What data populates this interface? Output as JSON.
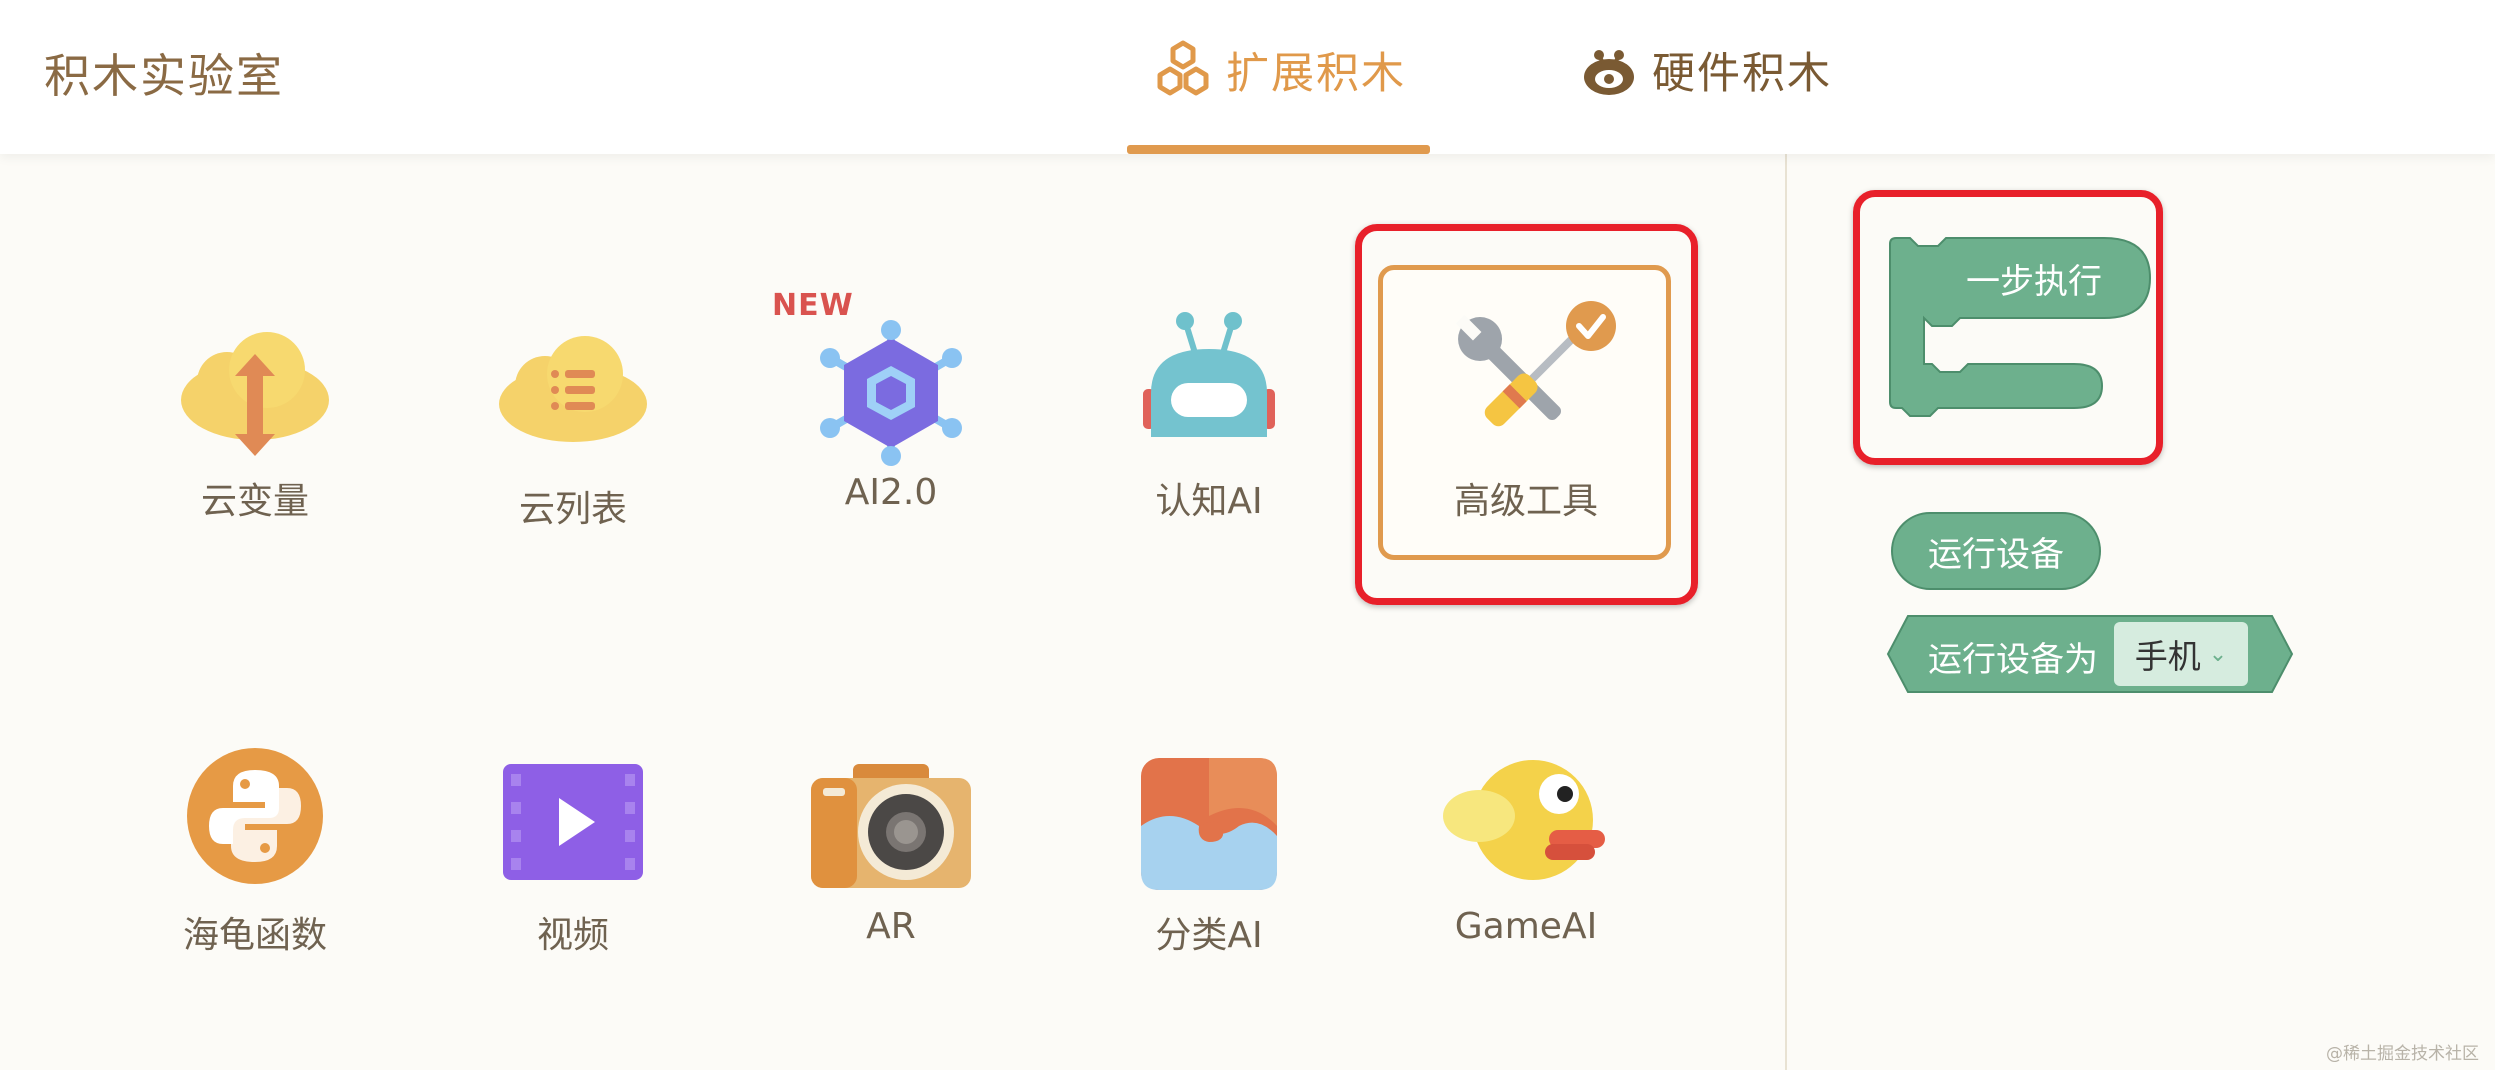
{
  "header": {
    "app_title": "积木实验室",
    "tabs": [
      {
        "label": "扩展积木",
        "active": true
      },
      {
        "label": "硬件积木",
        "active": false
      }
    ]
  },
  "extensions": {
    "new_badge": "NEW",
    "items": [
      {
        "label": "云变量",
        "icon": "cloud-variable-icon"
      },
      {
        "label": "云列表",
        "icon": "cloud-list-icon"
      },
      {
        "label": "AI2.0",
        "icon": "ai-hexagon-icon"
      },
      {
        "label": "认知AI",
        "icon": "robot-icon"
      },
      {
        "label": "高级工具",
        "icon": "wrench-screwdriver-icon",
        "selected": true
      },
      {
        "label": "海龟函数",
        "icon": "python-icon"
      },
      {
        "label": "视频",
        "icon": "video-icon"
      },
      {
        "label": "AR",
        "icon": "camera-icon"
      },
      {
        "label": "分类AI",
        "icon": "classify-icon"
      },
      {
        "label": "GameAI",
        "icon": "flappy-bird-icon"
      }
    ]
  },
  "blocks": {
    "step_block": "一步执行",
    "run_device": "运行设备",
    "run_device_as": "运行设备为",
    "device_option": "手机"
  },
  "colors": {
    "accent": "#e09a4e",
    "block_green": "#6db08d",
    "highlight_red": "#e8202a"
  },
  "watermark": "@稀土掘金技术社区"
}
